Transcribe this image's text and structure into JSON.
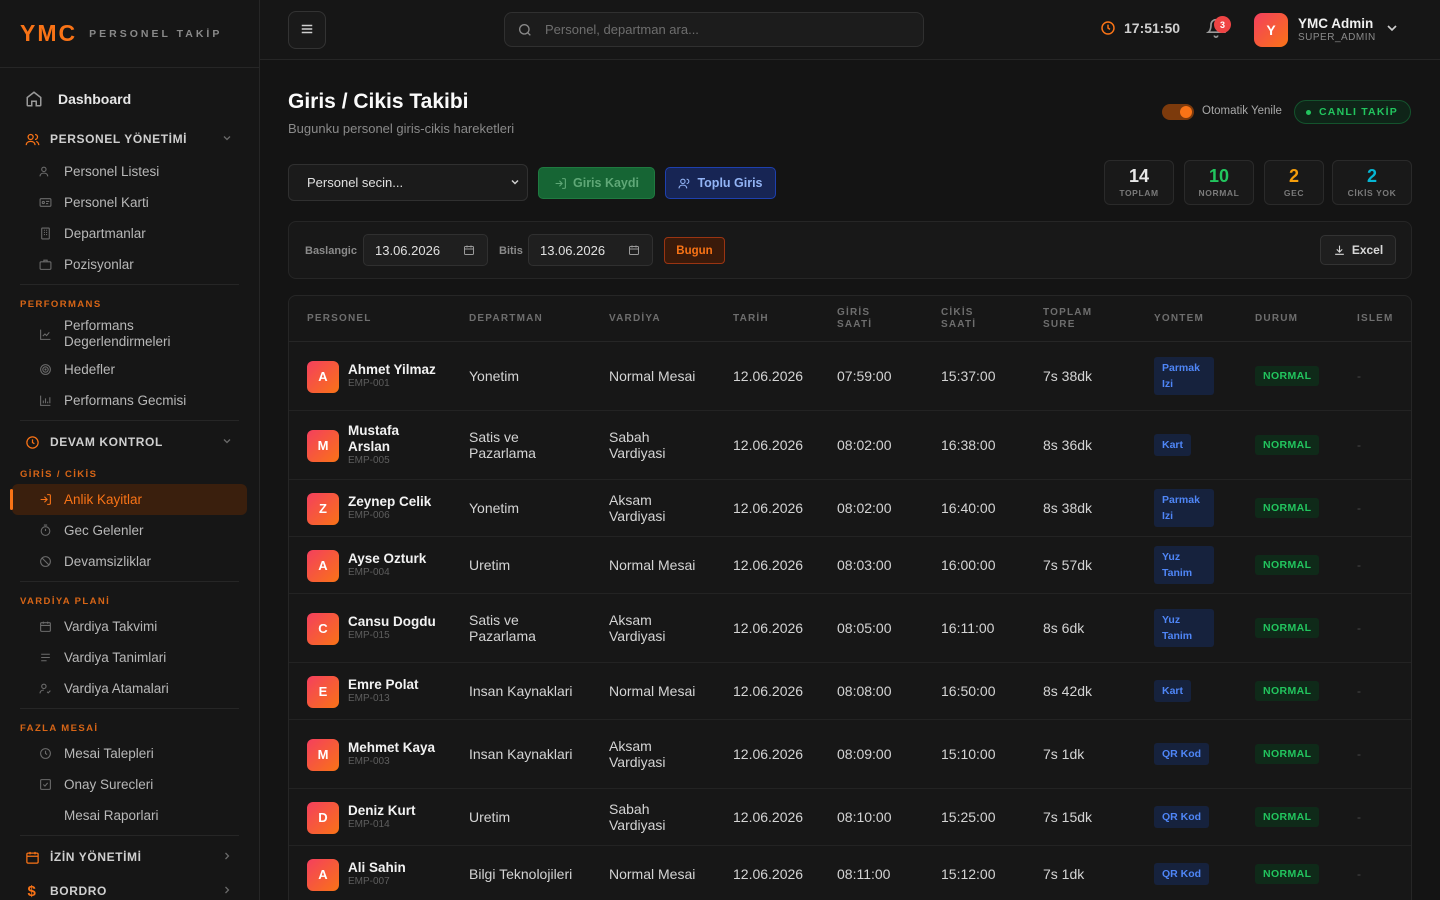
{
  "brand": {
    "logo": "YMC",
    "subtitle": "PERSONEL TAKİP"
  },
  "sidebar": {
    "dashboard": "Dashboard",
    "personel": {
      "title": "PERSONEL YÖNETİMİ",
      "items": [
        "Personel Listesi",
        "Personel Karti",
        "Departmanlar",
        "Pozisyonlar"
      ]
    },
    "performans": {
      "group": "PERFORMANS",
      "items": [
        "Performans Degerlendirmeleri",
        "Hedefler",
        "Performans Gecmisi"
      ]
    },
    "devam": {
      "title": "DEVAM KONTROL",
      "group": "GİRİS / CİKİS",
      "items": [
        "Anlik Kayitlar",
        "Gec Gelenler",
        "Devamsizliklar"
      ]
    },
    "vardiya": {
      "group": "VARDİYA PLANİ",
      "items": [
        "Vardiya Takvimi",
        "Vardiya Tanimlari",
        "Vardiya Atamalari"
      ]
    },
    "fazla": {
      "group": "FAZLA MESAİ",
      "items": [
        "Mesai Talepleri",
        "Onay Surecleri",
        "Mesai Raporlari"
      ]
    },
    "izin": "İZİN YÖNETİMİ",
    "bordro": "BORDRO"
  },
  "header": {
    "search_placeholder": "Personel, departman ara...",
    "clock": "17:51:50",
    "notifications": "3",
    "user_initial": "Y",
    "user_name": "YMC Admin",
    "user_role": "SUPER_ADMIN"
  },
  "page": {
    "title": "Giris / Cikis Takibi",
    "subtitle": "Bugunku personel giris-cikis hareketleri",
    "auto_refresh": "Otomatik Yenile",
    "live": "CANLI TAKİP",
    "select_placeholder": "Personel secin...",
    "btn_checkin": "Giris Kaydi",
    "btn_bulk": "Toplu Giris",
    "stats": [
      {
        "value": "14",
        "label": "TOPLAM",
        "color": "#e8e8e8"
      },
      {
        "value": "10",
        "label": "NORMAL",
        "color": "#22c55e"
      },
      {
        "value": "2",
        "label": "GEC",
        "color": "#f59e0b"
      },
      {
        "value": "2",
        "label": "CİKİS YOK",
        "color": "#06b6d4"
      }
    ],
    "filter": {
      "start_label": "Baslangic",
      "start_value": "13.06.2026",
      "end_label": "Bitis",
      "end_value": "13.06.2026",
      "today": "Bugun",
      "excel": "Excel"
    }
  },
  "table": {
    "headers": [
      "PERSONEL",
      "DEPARTMAN",
      "VARDİYA",
      "TARİH",
      "GİRİS SAATİ",
      "CİKİS SAATİ",
      "TOPLAM SURE",
      "YONTEM",
      "DURUM",
      "ISLEM"
    ],
    "rows": [
      {
        "initial": "A",
        "name": "Ahmet Yilmaz",
        "code": "EMP-001",
        "dept": "Yonetim",
        "shift": "Normal Mesai",
        "date": "12.06.2026",
        "in": "07:59:00",
        "out": "15:37:00",
        "total": "7s 38dk",
        "method": "Parmak Izi",
        "status": "NORMAL",
        "action": "-"
      },
      {
        "initial": "M",
        "name": "Mustafa Arslan",
        "code": "EMP-005",
        "dept": "Satis ve Pazarlama",
        "shift": "Sabah Vardiyasi",
        "date": "12.06.2026",
        "in": "08:02:00",
        "out": "16:38:00",
        "total": "8s 36dk",
        "method": "Kart",
        "status": "NORMAL",
        "action": "-"
      },
      {
        "initial": "Z",
        "name": "Zeynep Celik",
        "code": "EMP-006",
        "dept": "Yonetim",
        "shift": "Aksam Vardiyasi",
        "date": "12.06.2026",
        "in": "08:02:00",
        "out": "16:40:00",
        "total": "8s 38dk",
        "method": "Parmak Izi",
        "status": "NORMAL",
        "action": "-"
      },
      {
        "initial": "A",
        "name": "Ayse Ozturk",
        "code": "EMP-004",
        "dept": "Uretim",
        "shift": "Normal Mesai",
        "date": "12.06.2026",
        "in": "08:03:00",
        "out": "16:00:00",
        "total": "7s 57dk",
        "method": "Yuz Tanim",
        "status": "NORMAL",
        "action": "-"
      },
      {
        "initial": "C",
        "name": "Cansu Dogdu",
        "code": "EMP-015",
        "dept": "Satis ve Pazarlama",
        "shift": "Aksam Vardiyasi",
        "date": "12.06.2026",
        "in": "08:05:00",
        "out": "16:11:00",
        "total": "8s 6dk",
        "method": "Yuz Tanim",
        "status": "NORMAL",
        "action": "-"
      },
      {
        "initial": "E",
        "name": "Emre Polat",
        "code": "EMP-013",
        "dept": "Insan Kaynaklari",
        "shift": "Normal Mesai",
        "date": "12.06.2026",
        "in": "08:08:00",
        "out": "16:50:00",
        "total": "8s 42dk",
        "method": "Kart",
        "status": "NORMAL",
        "action": "-"
      },
      {
        "initial": "M",
        "name": "Mehmet Kaya",
        "code": "EMP-003",
        "dept": "Insan Kaynaklari",
        "shift": "Aksam Vardiyasi",
        "date": "12.06.2026",
        "in": "08:09:00",
        "out": "15:10:00",
        "total": "7s 1dk",
        "method": "QR Kod",
        "status": "NORMAL",
        "action": "-"
      },
      {
        "initial": "D",
        "name": "Deniz Kurt",
        "code": "EMP-014",
        "dept": "Uretim",
        "shift": "Sabah Vardiyasi",
        "date": "12.06.2026",
        "in": "08:10:00",
        "out": "15:25:00",
        "total": "7s 15dk",
        "method": "QR Kod",
        "status": "NORMAL",
        "action": "-"
      },
      {
        "initial": "A",
        "name": "Ali Sahin",
        "code": "EMP-007",
        "dept": "Bilgi Teknolojileri",
        "shift": "Normal Mesai",
        "date": "12.06.2026",
        "in": "08:11:00",
        "out": "15:12:00",
        "total": "7s 1dk",
        "method": "QR Kod",
        "status": "NORMAL",
        "action": "-"
      }
    ]
  }
}
